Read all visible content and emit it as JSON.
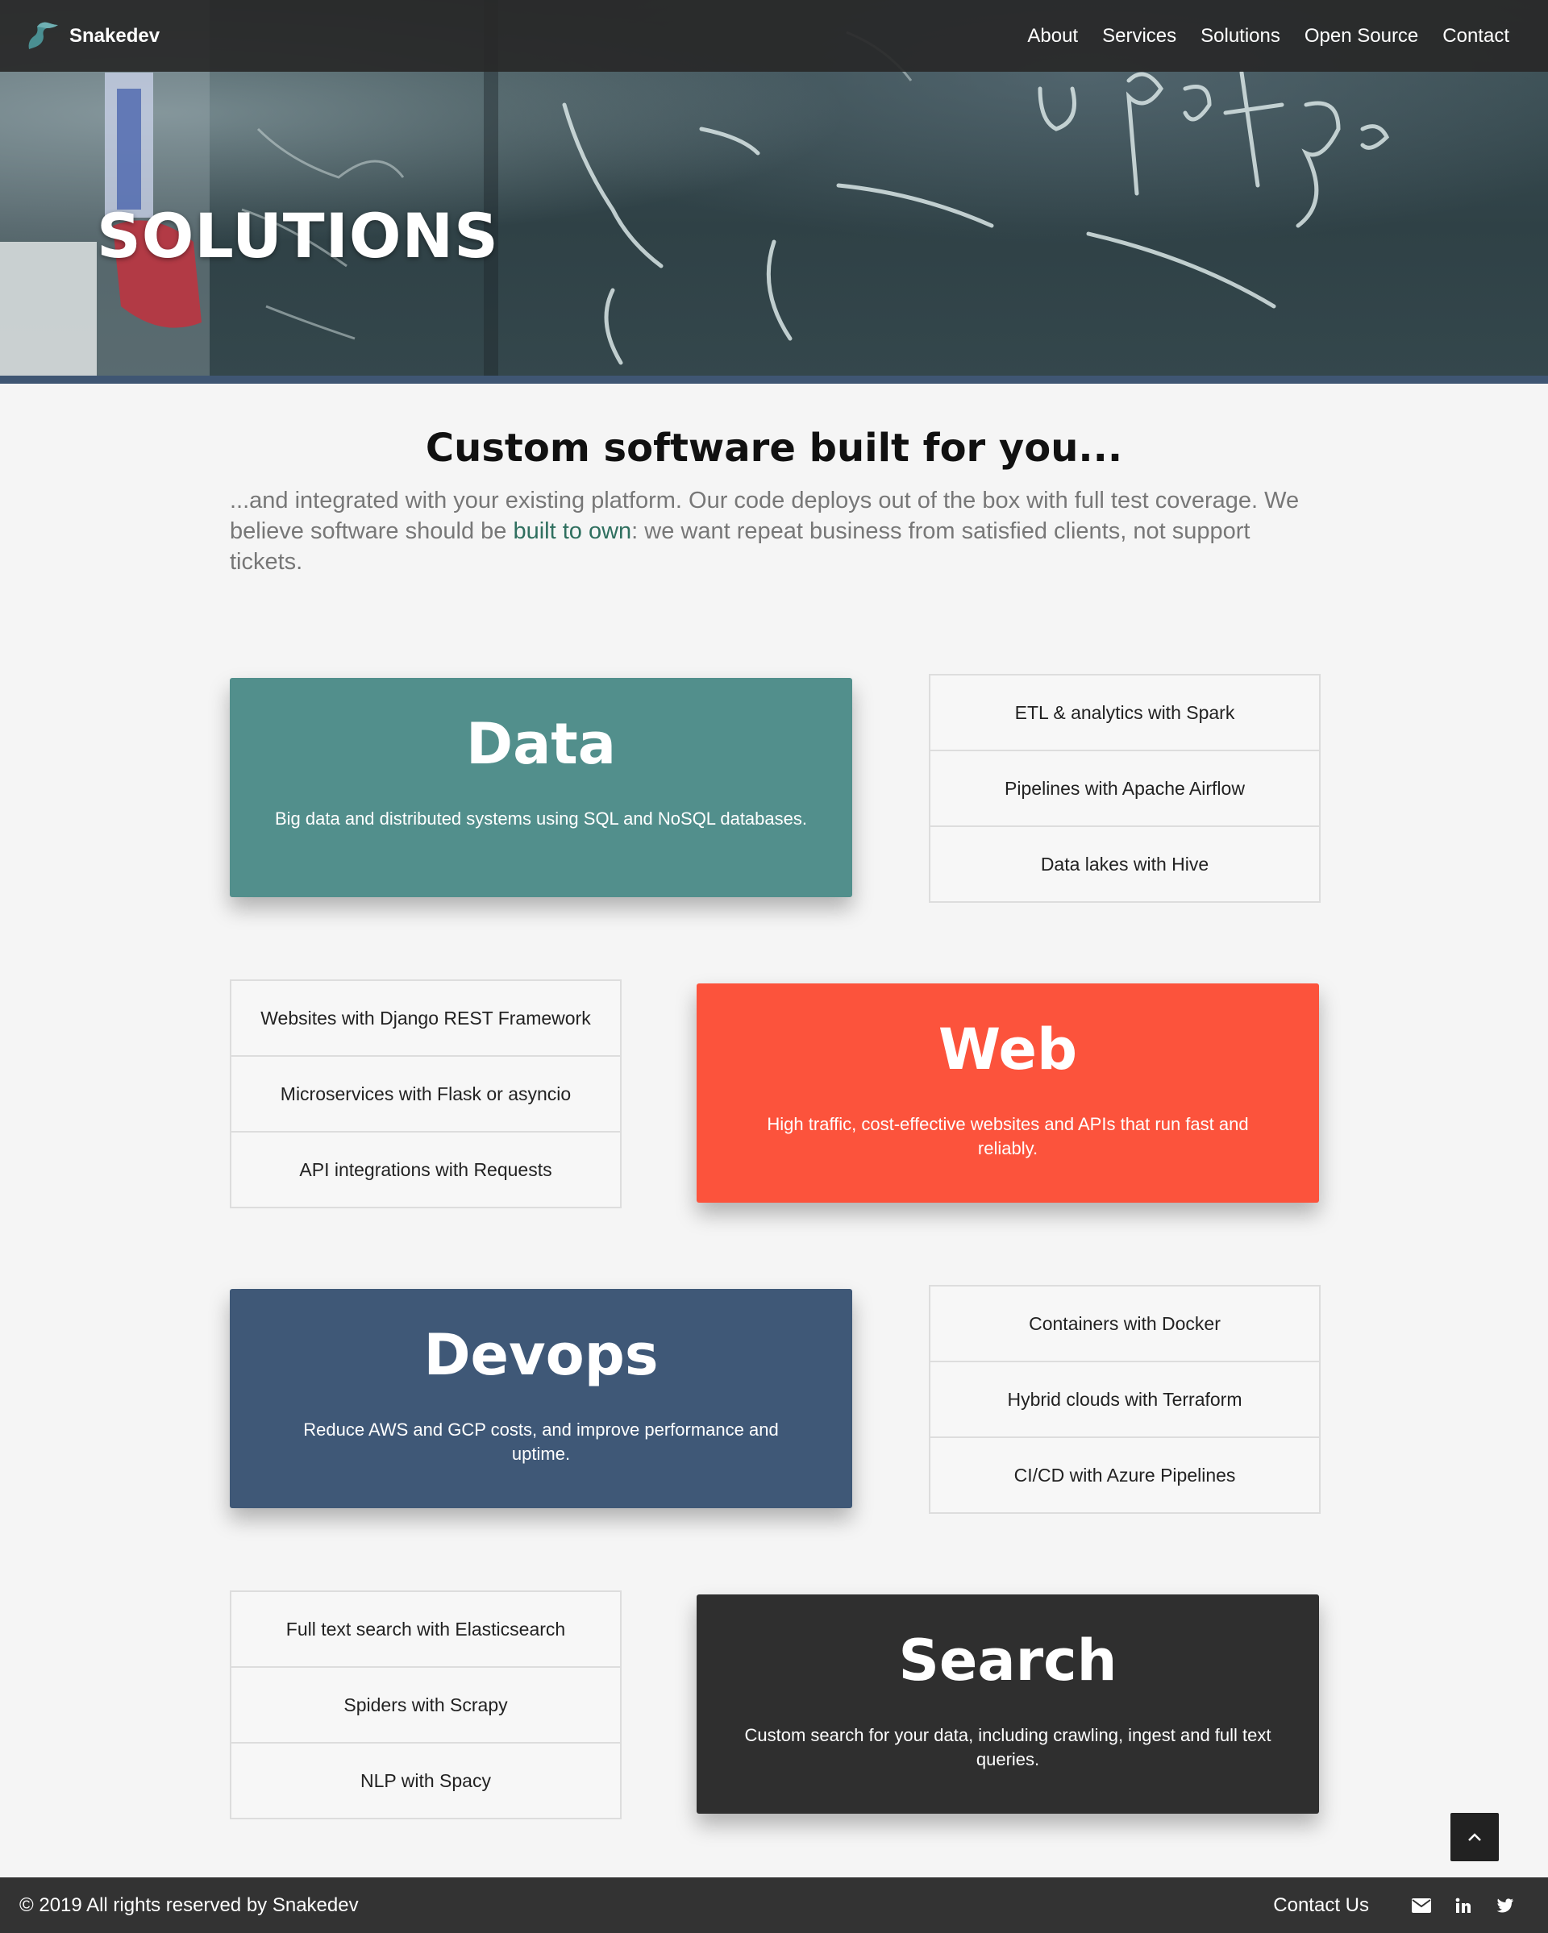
{
  "nav": {
    "brand": "Snakedev",
    "links": [
      "About",
      "Services",
      "Solutions",
      "Open Source",
      "Contact"
    ]
  },
  "hero": {
    "title": "SOLUTIONS"
  },
  "intro": {
    "heading": "Custom software built for you...",
    "text_before": "...and integrated with your existing platform. Our code deploys out of the box with full test coverage. We believe software should be ",
    "link": "built to own",
    "text_after": ": we want repeat business from satisfied clients, not support tickets."
  },
  "sections": [
    {
      "title": "Data",
      "description": "Big data and distributed systems using SQL and NoSQL databases.",
      "color": "#528f8c",
      "items": [
        "ETL & analytics with Spark",
        "Pipelines with Apache Airflow",
        "Data lakes with Hive"
      ]
    },
    {
      "title": "Web",
      "description": "High traffic, cost-effective websites and APIs that run fast and reliably.",
      "color": "#fc533c",
      "items": [
        "Websites with Django REST Framework",
        "Microservices with Flask or asyncio",
        "API integrations with Requests"
      ]
    },
    {
      "title": "Devops",
      "description": "Reduce AWS and GCP costs, and improve performance and uptime.",
      "color": "#3f5877",
      "items": [
        "Containers with Docker",
        "Hybrid clouds with Terraform",
        "CI/CD with Azure Pipelines"
      ]
    },
    {
      "title": "Search",
      "description": "Custom search for your data, including crawling, ingest and full text queries.",
      "color": "#2f2f2f",
      "items": [
        "Full text search with Elasticsearch",
        "Spiders with Scrapy",
        "NLP with Spacy"
      ]
    }
  ],
  "footer": {
    "copyright": "© 2019 All rights reserved by Snakedev",
    "contact": "Contact Us"
  }
}
